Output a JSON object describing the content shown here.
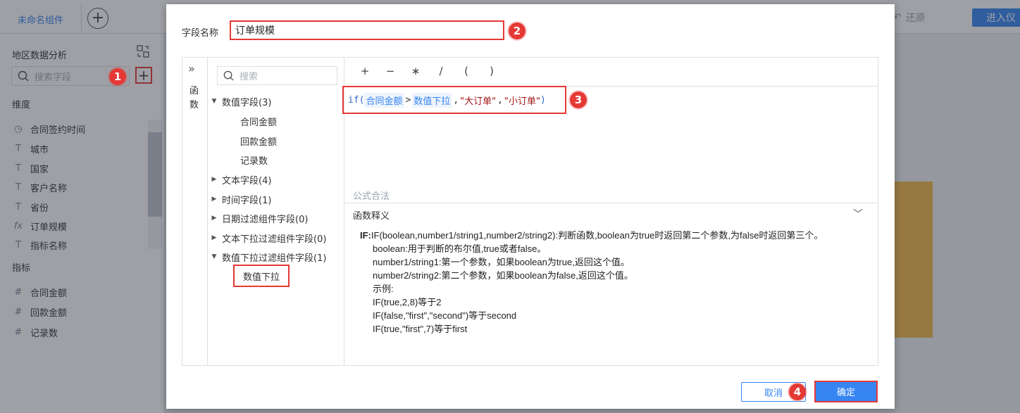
{
  "topbar": {
    "active_tab": "未命名组件",
    "add_tab": "+",
    "restore": "还原",
    "enter": "进入仪"
  },
  "left_panel": {
    "title": "地区数据分析",
    "search_placeholder": "搜索字段",
    "plus": "+",
    "dimension_label": "维度",
    "dimensions": [
      {
        "icon": "clock-icon",
        "label": "合同签约时间"
      },
      {
        "icon": "text-field-icon",
        "label": "城市"
      },
      {
        "icon": "text-field-icon",
        "label": "国家"
      },
      {
        "icon": "text-field-icon",
        "label": "客户名称"
      },
      {
        "icon": "text-field-icon",
        "label": "省份"
      },
      {
        "icon": "formula-icon",
        "label": "订单规模"
      },
      {
        "icon": "text-field-icon",
        "label": "指标名称"
      }
    ],
    "measure_label": "指标",
    "measures": [
      {
        "icon": "hash-icon",
        "label": "合同金额"
      },
      {
        "icon": "hash-icon",
        "label": "回款金额"
      },
      {
        "icon": "hash-icon",
        "label": "记录数"
      }
    ]
  },
  "dialog": {
    "field_name_label": "字段名称",
    "field_name_value": "订单规模",
    "fn_strip_label": "函数",
    "fn_strip_expand": "»",
    "field_search_placeholder": "搜索",
    "tree": {
      "numeric": "数值字段(3)",
      "numeric_children": [
        "合同金额",
        "回款金额",
        "记录数"
      ],
      "text": "文本字段(4)",
      "time": "时间字段(1)",
      "date_filter": "日期过滤组件字段(0)",
      "text_filter": "文本下拉过滤组件字段(0)",
      "num_filter": "数值下拉过滤组件字段(1)",
      "num_filter_child": "数值下拉"
    },
    "operators": [
      "+",
      "−",
      "∗",
      "/",
      "(",
      ")"
    ],
    "formula": {
      "fn": "if(",
      "field1": "合同金额",
      "op": ">",
      "field2": "数值下拉",
      "comma1": ",",
      "str1": "\"大订单\"",
      "comma2": ",",
      "str2": "\"小订单\"",
      "close": ")"
    },
    "legal": "公式合法",
    "explain_title": "函数释义",
    "explain": {
      "head": "IF:",
      "line1": "IF(boolean,number1/string1,number2/string2):判断函数,boolean为true时返回第二个参数,为false时返回第三个。",
      "line2": "boolean:用于判断的布尔值,true或者false。",
      "line3": "number1/string1:第一个参数，如果boolean为true,返回这个值。",
      "line4": "number2/string2:第二个参数，如果boolean为false,返回这个值。",
      "line5": "示例:",
      "line6": "IF(true,2,8)等于2",
      "line7": "IF(false,\"first\",\"second\")等于second",
      "line8": "IF(true,\"first\",7)等于first"
    },
    "cancel": "取消",
    "ok": "确定"
  },
  "badges": [
    "1",
    "2",
    "3",
    "4"
  ],
  "colors": {
    "accent": "#3685f2",
    "highlight": "#e53935",
    "bar": "#f0b849"
  }
}
